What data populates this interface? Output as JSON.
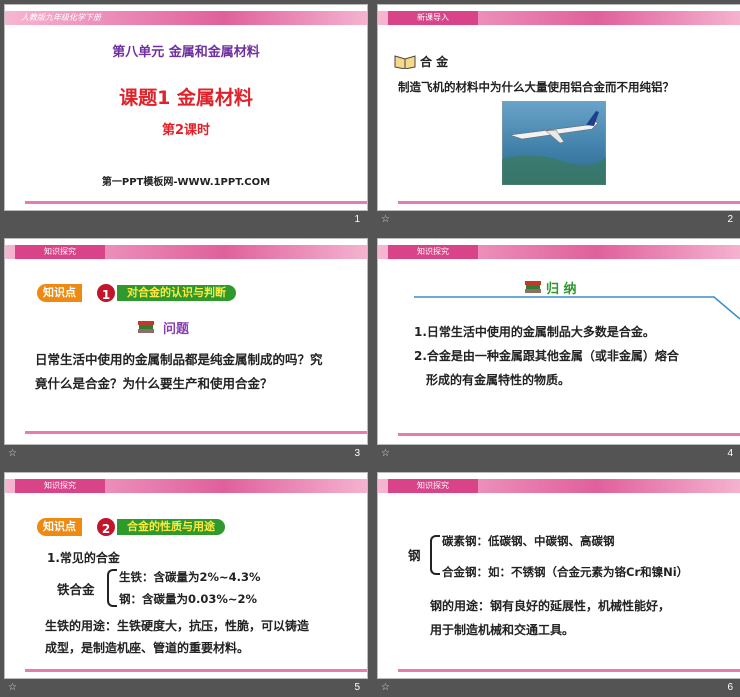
{
  "slides": [
    {
      "number": "1",
      "banner": "人教版九年级化学下册",
      "unit": "第八单元  金属和金属材料",
      "title": "课题1  金属材料",
      "subtitle": "第2课时",
      "credit": "第一PPT模板网-WWW.1PPT.COM"
    },
    {
      "number": "2",
      "header": "新课导入",
      "topic": "合 金",
      "question": "制造飞机的材料中为什么大量使用铝合金而不用纯铝？"
    },
    {
      "number": "3",
      "header": "知识探究",
      "kp_label": "知识点",
      "kp_num": "1",
      "kp_title": "对合金的认识与判断",
      "section": "问题",
      "line1": "日常生活中使用的金属制品都是纯金属制成的吗？究",
      "line2": "竟什么是合金？为什么要生产和使用合金？"
    },
    {
      "number": "4",
      "header": "知识探究",
      "section": "归  纳",
      "line1": "1.日常生活中使用的金属制品大多数是合金。",
      "line2": "2.合金是由一种金属跟其他金属（或非金属）熔合",
      "line3": "形成的有金属特性的物质。"
    },
    {
      "number": "5",
      "header": "知识探究",
      "kp_label": "知识点",
      "kp_num": "2",
      "kp_title": "合金的性质与用途",
      "h1": "1.常见的合金",
      "group": "铁合金",
      "item1": "生铁：含碳量为2%~4.3%",
      "item2": "钢：含碳量为0.03%~2%",
      "line1": "生铁的用途：生铁硬度大，抗压，性脆，可以铸造",
      "line2": "成型，是制造机座、管道的重要材料。"
    },
    {
      "number": "6",
      "header": "知识探究",
      "group": "钢",
      "item1": "碳素钢：低碳钢、中碳钢、高碳钢",
      "item2": "合金钢：如：不锈钢（合金元素为铬Cr和镍Ni）",
      "line1": "钢的用途：钢有良好的延展性，机械性能好，",
      "line2": "用于制造机械和交通工具。"
    }
  ],
  "colors": {
    "accent": "#e0609b",
    "title_red": "#e0222a",
    "unit_purple": "#7030a0",
    "kp_orange": "#ee8a12",
    "kp_green": "#2e9a2e"
  },
  "icons": {
    "star": "star-icon",
    "book": "book-icon",
    "airplane": "airplane-image"
  }
}
